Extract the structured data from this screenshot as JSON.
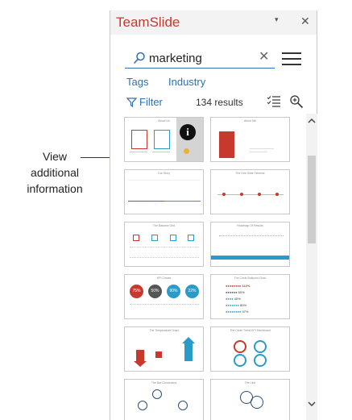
{
  "annotation": {
    "text_lines": [
      "View",
      "additional",
      "information"
    ]
  },
  "header": {
    "app_title": "TeamSlide",
    "pin_glyph": "▾",
    "close_glyph": "✕"
  },
  "search": {
    "value": "marketing",
    "clear_glyph": "✕"
  },
  "tabs": [
    "Tags",
    "Industry"
  ],
  "toolbar": {
    "filter_label": "Filter",
    "result_count": "134 results"
  },
  "thumbnails": [
    {
      "title": "About Us",
      "highlighted": true
    },
    {
      "title": "About Me"
    },
    {
      "title": "Our Story"
    },
    {
      "title": "The One Slide Timeline"
    },
    {
      "title": "The Balance Grid"
    },
    {
      "title": "Roadmap Of Results"
    },
    {
      "title": "KPI Circles",
      "percents": [
        "75%",
        "50%",
        "90%",
        "22%"
      ]
    },
    {
      "title": "The Circle Bullpoint Chart",
      "percents": [
        "110%",
        "60%",
        "40%",
        "80%",
        "97%"
      ]
    },
    {
      "title": "The Temperature Chart"
    },
    {
      "title": "The Circle Trend KPI Dashboard"
    },
    {
      "title": "The Bar Connectors"
    },
    {
      "title": "The Link"
    }
  ],
  "colors": {
    "brand": "#c7392d",
    "accent_blue": "#2f6fb2",
    "chart_teal": "#2a9bc9",
    "info_yellow": "#e8b339"
  }
}
